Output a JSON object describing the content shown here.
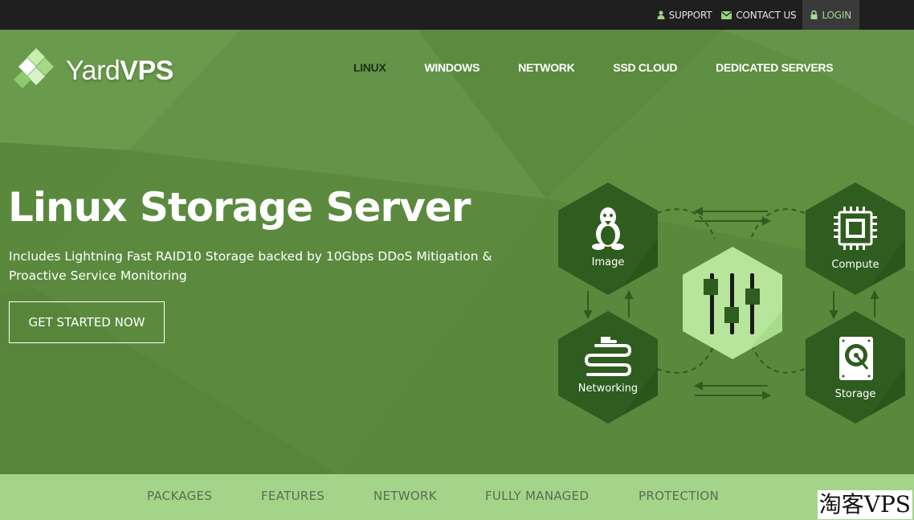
{
  "topbar": {
    "links": [
      {
        "label": "SUPPORT",
        "icon": "user-icon"
      },
      {
        "label": "CONTACT US",
        "icon": "envelope-icon"
      },
      {
        "label": "LOGIN",
        "icon": "lock-icon"
      }
    ]
  },
  "brand": {
    "name_light": "Yard",
    "name_bold": "VPS"
  },
  "nav": {
    "items": [
      "LINUX",
      "WINDOWS",
      "NETWORK",
      "SSD CLOUD",
      "DEDICATED SERVERS"
    ],
    "active": "LINUX"
  },
  "hero": {
    "title": "Linux Storage Server",
    "subtitle": "Includes Lightning Fast RAID10 Storage backed by 10Gbps DDoS Mitigation & Proactive Service Monitoring",
    "cta": "GET STARTED NOW"
  },
  "diagram": {
    "nodes": [
      {
        "label": "Image",
        "icon": "linux-penguin-icon"
      },
      {
        "label": "Compute",
        "icon": "cpu-chip-icon"
      },
      {
        "label": "Networking",
        "icon": "network-cable-icon"
      },
      {
        "label": "Storage",
        "icon": "hard-drive-icon"
      }
    ],
    "center_icon": "sliders-icon"
  },
  "subnav": {
    "items": [
      "PACKAGES",
      "FEATURES",
      "NETWORK",
      "FULLY MANAGED",
      "PROTECTION"
    ]
  },
  "watermark": "淘客VPS",
  "colors": {
    "topbar": "#1f1f1f",
    "hero": "#5f8f42",
    "hex_dark": "#2f5c1f",
    "hex_center": "#b7e59b",
    "subnav": "#a4d48a",
    "login_bg": "#3a3a3a"
  }
}
